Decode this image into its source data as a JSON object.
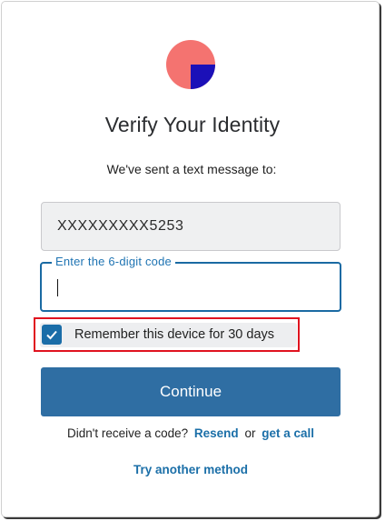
{
  "colors": {
    "logo_salmon": "#f47370",
    "logo_blue": "#1b10b8",
    "accent": "#2f6ea3",
    "focus_border": "#1a6aa3",
    "link": "#1b6fa8",
    "highlight_border": "#e0131f"
  },
  "logo": {
    "icon": "brand-logo-icon"
  },
  "header": {
    "title": "Verify Your Identity",
    "subtitle": "We've sent a text message to:"
  },
  "phone": {
    "value": "XXXXXXXXX5253"
  },
  "code_input": {
    "label": "Enter the 6-digit code",
    "value": ""
  },
  "remember": {
    "label": "Remember this device for 30 days",
    "checked": true,
    "icon": "checkmark-icon"
  },
  "actions": {
    "continue_label": "Continue",
    "no_code_text": "Didn't receive a code?",
    "resend_label": "Resend",
    "or_text": "or",
    "call_label": "get a call",
    "try_another_label": "Try another method"
  }
}
